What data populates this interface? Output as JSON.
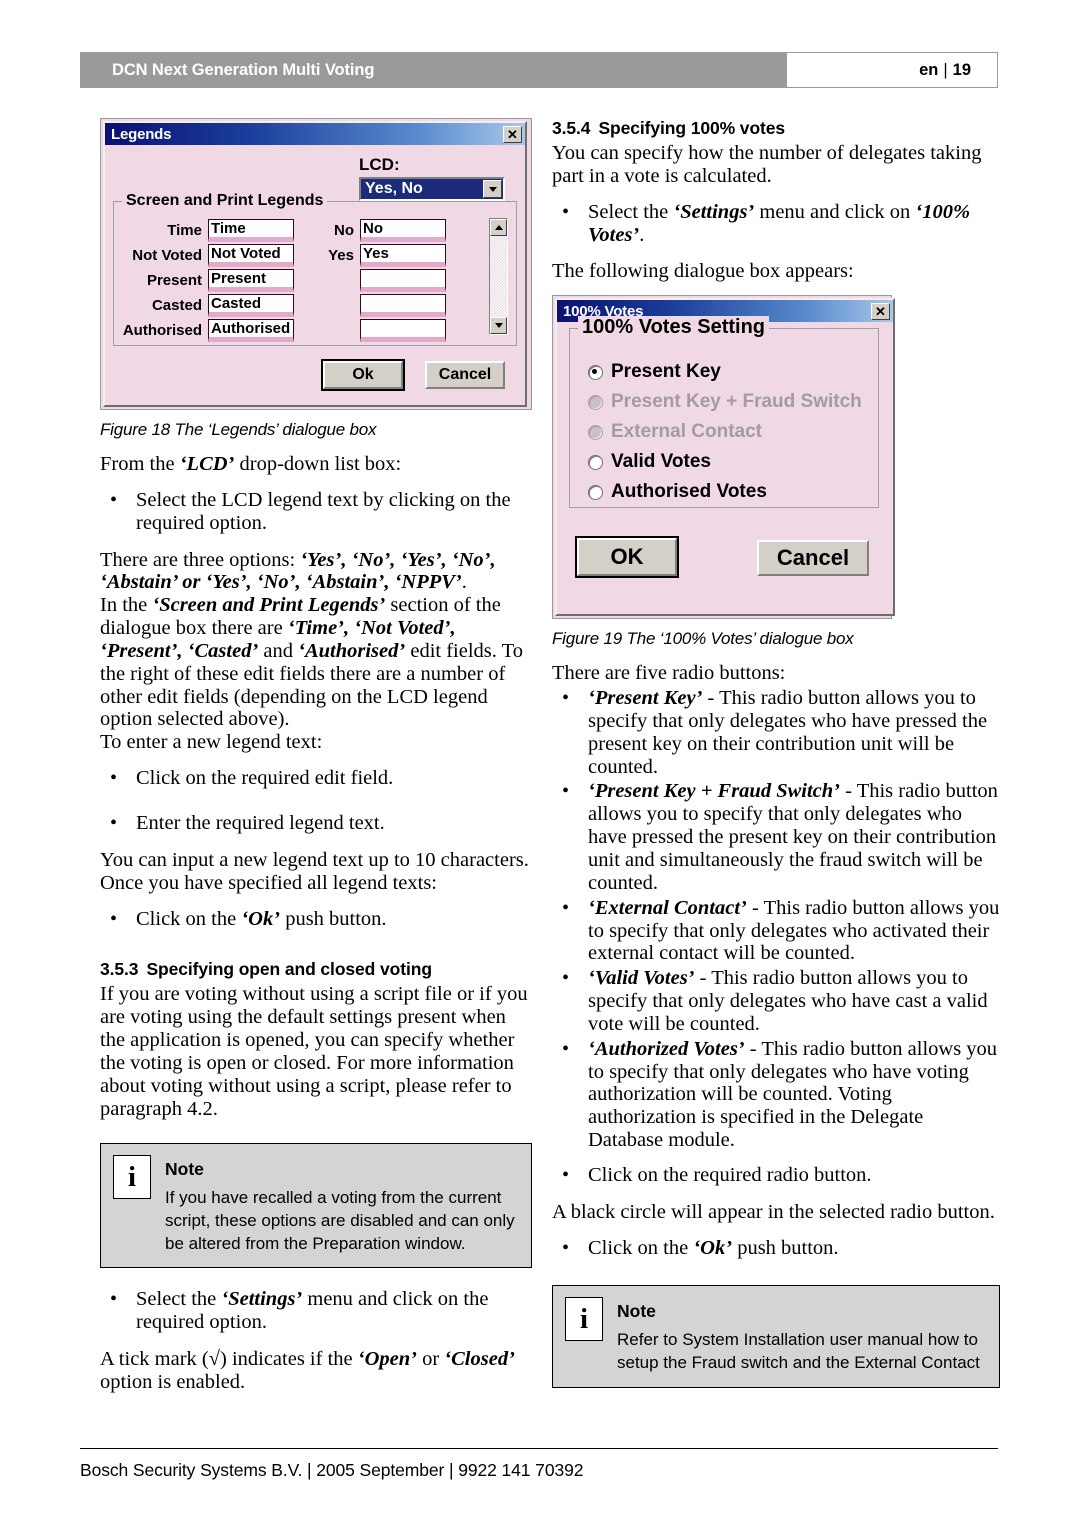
{
  "header": {
    "title": "DCN Next Generation Multi Voting",
    "lang": "en",
    "separator": "|",
    "page": "19"
  },
  "footer": {
    "text": "Bosch Security Systems B.V. | 2005 September | 9922 141 70392"
  },
  "legends_dialog": {
    "title": "Legends",
    "close_icon": "✕",
    "lcd_label": "LCD:",
    "lcd_value": "Yes, No",
    "group_title": "Screen and Print Legends",
    "left_fields": [
      {
        "label": "Time",
        "value": "Time"
      },
      {
        "label": "Not Voted",
        "value": "Not Voted"
      },
      {
        "label": "Present",
        "value": "Present"
      },
      {
        "label": "Casted",
        "value": "Casted"
      },
      {
        "label": "Authorised",
        "value": "Authorised"
      }
    ],
    "right_fields": [
      {
        "label": "No",
        "value": "No"
      },
      {
        "label": "Yes",
        "value": "Yes"
      },
      {
        "label": "",
        "value": ""
      },
      {
        "label": "",
        "value": ""
      },
      {
        "label": "",
        "value": ""
      }
    ],
    "ok_label": "Ok",
    "cancel_label": "Cancel"
  },
  "votes_dialog": {
    "title": "100% Votes",
    "close_icon": "✕",
    "group_title": "100% Votes Setting",
    "radios": [
      {
        "label": "Present Key",
        "checked": true,
        "disabled": false
      },
      {
        "label": "Present Key + Fraud Switch",
        "checked": false,
        "disabled": true
      },
      {
        "label": "External Contact",
        "checked": false,
        "disabled": true
      },
      {
        "label": "Valid Votes",
        "checked": false,
        "disabled": false
      },
      {
        "label": "Authorised Votes",
        "checked": false,
        "disabled": false
      }
    ],
    "ok_label": "OK",
    "cancel_label": "Cancel"
  },
  "left_column": {
    "figure18_caption": "Figure 18 The ‘Legends’ dialogue box",
    "para_lcd_intro_a": "From the ",
    "para_lcd_intro_b": "‘LCD’",
    "para_lcd_intro_c": " drop-down list box:",
    "bullet_select_lcd": "Select the LCD legend text by clicking on the required option.",
    "three_options_a": "There are three options: ",
    "three_options_b": "‘Yes’, ‘No’, ‘Yes’, ‘No’, ‘Abstain’ or ‘Yes’, ‘No’, ‘Abstain’, ‘NPPV’",
    "three_options_c": ".",
    "screen_print_a": "In the ",
    "screen_print_b": "‘Screen and Print Legends’",
    "screen_print_c": " section of the dialogue box there are ",
    "screen_print_d": "‘Time’, ‘Not Voted’, ‘Present’, ‘Casted’",
    "screen_print_e": " and ",
    "screen_print_f": "‘Authorised’",
    "screen_print_g": " edit fields. To the right of these edit fields there are a number of other edit fields (depending on the LCD legend option selected above).",
    "enter_new_legend": "To enter a new legend text:",
    "bullet_click_edit": "Click on the required edit field.",
    "bullet_enter_legend": "Enter the required legend text.",
    "input_10_chars": "You can input a new legend text up to 10 characters. Once you have specified all legend texts:",
    "bullet_click_ok_a": "Click on the ",
    "bullet_click_ok_b": "‘Ok’",
    "bullet_click_ok_c": " push button.",
    "heading_353_num": "3.5.3",
    "heading_353_text": "Specifying open and closed voting",
    "para_353": "If you are voting without using a script file or if you are voting using the default settings present when the application is opened, you can specify whether the voting is open or closed. For more information about voting without using a script, please refer to paragraph 4.2.",
    "note_title": "Note",
    "note_text": "If you have recalled a voting from the current script, these options are disabled and can only be altered from the Preparation window.",
    "bullet_settings_a": "Select the ",
    "bullet_settings_b": "‘Settings’",
    "bullet_settings_c": " menu and click on the required option.",
    "tick_mark_a": "A tick mark (√) indicates if the ",
    "tick_mark_b": "‘Open’",
    "tick_mark_c": " or ",
    "tick_mark_d": "‘Closed’",
    "tick_mark_e": " option is enabled."
  },
  "right_column": {
    "heading_354_num": "3.5.4",
    "heading_354_text": "Specifying 100% votes",
    "para_354": "You can specify how the number of delegates taking part in a vote is calculated.",
    "bullet_settings_a": "Select the ",
    "bullet_settings_b": "‘Settings’",
    "bullet_settings_c": " menu and click on ",
    "bullet_settings_d": "‘100% Votes’",
    "bullet_settings_e": ".",
    "following_dialogue": "The following dialogue box appears:",
    "figure19_caption": "Figure 19 The ‘100% Votes’ dialogue box",
    "five_radio_buttons": "There are five radio buttons:",
    "radio_descriptions": [
      {
        "term": "‘Present Key’",
        "desc": " - This radio button allows you to specify that only delegates who have pressed the present key on their contribution unit will be counted."
      },
      {
        "term": "‘Present Key + Fraud Switch’",
        "desc": " - This radio button allows you to specify that only delegates who have pressed the present key on their contribution unit and simultaneously the fraud switch will be counted."
      },
      {
        "term": "‘External Contact’",
        "desc": " - This radio button allows you to specify that only delegates who activated their external contact will be counted."
      },
      {
        "term": "‘Valid Votes’",
        "desc": " - This radio button allows you to specify that only delegates who have cast a valid vote will be counted."
      },
      {
        "term": "‘Authorized Votes’",
        "desc": " - This radio button allows you to specify that only delegates who have voting authorization will be counted. Voting authorization is specified in the Delegate Database module."
      }
    ],
    "bullet_click_radio": "Click on the required radio button.",
    "black_circle": "A black circle will appear in the selected radio button.",
    "bullet_click_ok_a": "Click on the ",
    "bullet_click_ok_b": "‘Ok’",
    "bullet_click_ok_c": " push button.",
    "note_title": "Note",
    "note_text": "Refer to System Installation user manual how to setup the Fraud switch and the External Contact"
  },
  "bullet_glyph": "•"
}
